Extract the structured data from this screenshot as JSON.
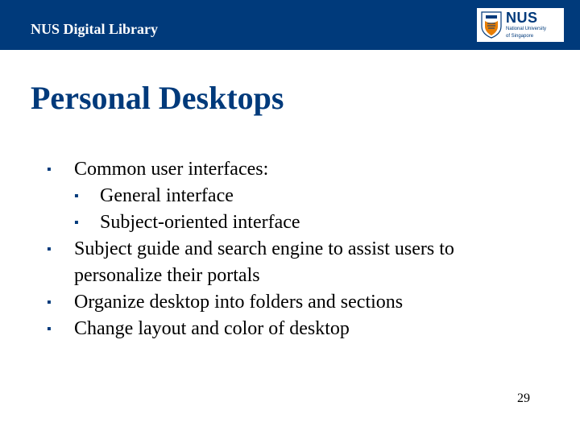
{
  "header": {
    "title": "NUS Digital Library",
    "logo_word": "NUS",
    "logo_sub1": "National University",
    "logo_sub2": "of Singapore"
  },
  "slide": {
    "title": "Personal Desktops"
  },
  "bullets": {
    "b1": "Common user interfaces:",
    "b1a": "General interface",
    "b1b": "Subject-oriented interface",
    "b2": "Subject guide and search engine to assist users to personalize their portals",
    "b3": "Organize desktop into folders and sections",
    "b4": "Change layout and color of desktop"
  },
  "page_number": "29"
}
